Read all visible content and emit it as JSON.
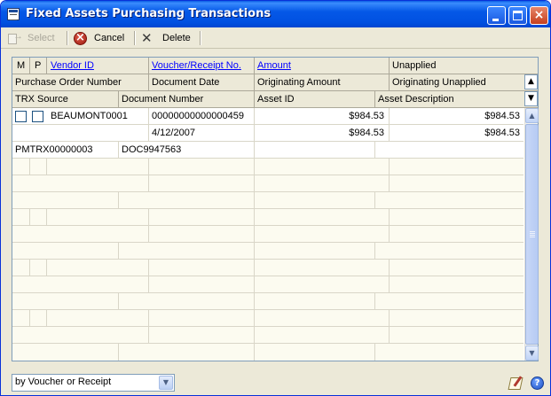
{
  "window": {
    "title": "Fixed Assets Purchasing Transactions",
    "close_glyph": "×"
  },
  "toolbar": {
    "select_label": "Select",
    "cancel_label": "Cancel",
    "delete_label": "Delete"
  },
  "grid": {
    "header_row1": {
      "m": "M",
      "p": "P",
      "vendor_id": "Vendor ID",
      "voucher": "Voucher/Receipt No.",
      "amount": "Amount",
      "unapplied": "Unapplied"
    },
    "header_row2": {
      "po_number": "Purchase Order Number",
      "document_date": "Document Date",
      "originating_amount": "Originating Amount",
      "originating_unapplied": "Originating Unapplied"
    },
    "header_row3": {
      "trx_source": "TRX Source",
      "document_number": "Document Number",
      "asset_id": "Asset ID",
      "asset_description": "Asset Description"
    },
    "expand_icon": "expand-all-icon",
    "collapse_icon": "collapse-all-icon",
    "record": {
      "vendor_id": "BEAUMONT0001",
      "voucher": "00000000000000459",
      "amount": "$984.53",
      "unapplied": "$984.53",
      "document_date": "4/12/2007",
      "originating_amount": "$984.53",
      "originating_unapplied": "$984.53",
      "trx_source": "PMTRX00000003",
      "document_number": "DOC9947563"
    }
  },
  "footer": {
    "sort_by": "by Voucher or Receipt"
  }
}
